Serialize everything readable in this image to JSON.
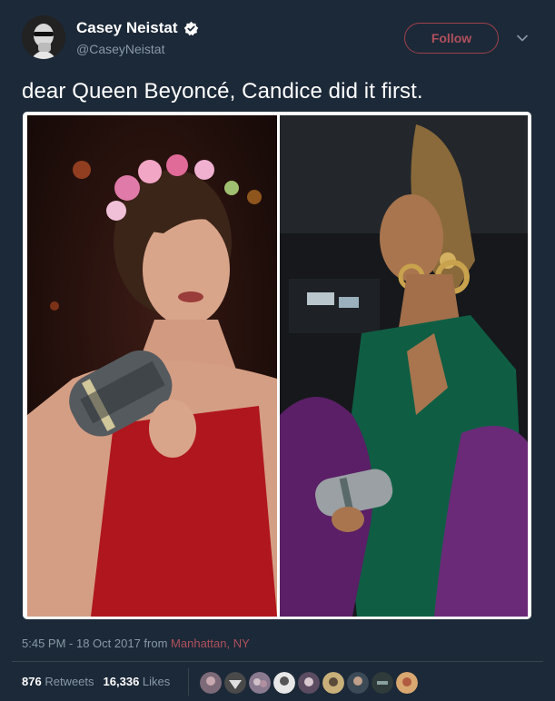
{
  "user": {
    "name": "Casey Neistat",
    "handle": "@CaseyNeistat",
    "verified": true
  },
  "follow_label": "Follow",
  "tweet_text": "dear Queen Beyoncé, Candice did it first.",
  "meta": {
    "time": "5:45 PM - 18 Oct 2017",
    "from": "from",
    "location": "Manhattan, NY"
  },
  "stats": {
    "retweets_count": "876",
    "retweets_label": "Retweets",
    "likes_count": "16,336",
    "likes_label": "Likes"
  },
  "colors": {
    "background": "#1c2938",
    "muted": "#8899a6",
    "accent": "#b0505c",
    "verified": "#ffffff"
  },
  "icons": {
    "verified": "verified-badge-icon",
    "caret": "chevron-down-icon"
  }
}
